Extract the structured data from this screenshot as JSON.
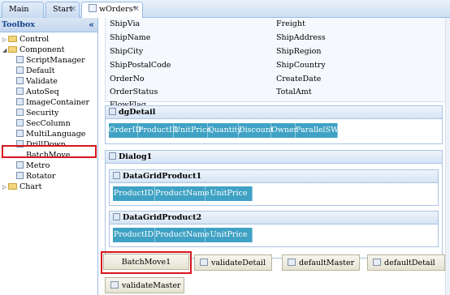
{
  "tabs": [
    {
      "label": "Main"
    },
    {
      "label": "Start"
    },
    {
      "label": "wOrders*"
    }
  ],
  "toolbox": {
    "title": "Toolbox",
    "items": [
      {
        "label": "Control"
      },
      {
        "label": "Component"
      },
      {
        "label": "ScriptManager"
      },
      {
        "label": "Default"
      },
      {
        "label": "Validate"
      },
      {
        "label": "AutoSeq"
      },
      {
        "label": "ImageContainer"
      },
      {
        "label": "Security"
      },
      {
        "label": "SecColumn"
      },
      {
        "label": "MultiLanguage"
      },
      {
        "label": "DrillDown"
      },
      {
        "label": "BatchMove"
      },
      {
        "label": "Metro"
      },
      {
        "label": "Rotator"
      },
      {
        "label": "Chart"
      }
    ]
  },
  "form": {
    "left": [
      "ShipVia",
      "ShipName",
      "ShipCity",
      "ShipPostalCode",
      "OrderNo",
      "OrderStatus",
      "FlowFlag"
    ],
    "right": [
      "Freight",
      "ShipAddress",
      "ShipRegion",
      "ShipCountry",
      "CreateDate",
      "TotalAmt"
    ]
  },
  "dgDetail": {
    "title": "dgDetail",
    "columns": [
      "OrderID",
      "ProductID",
      "UnitPrice",
      "Quantity",
      "Discount",
      "Owner",
      "ParallelSWT"
    ]
  },
  "dialog": {
    "title": "Dialog1",
    "grids": [
      {
        "title": "DataGridProduct1",
        "columns": [
          "ProductID",
          "ProductName",
          "UnitPrice"
        ]
      },
      {
        "title": "DataGridProduct2",
        "columns": [
          "ProductID",
          "ProductName",
          "UnitPrice"
        ]
      }
    ]
  },
  "components": [
    "BatchMove1",
    "validateDetail",
    "defaultMaster",
    "defaultDetail",
    "validateMaster"
  ],
  "colors": {
    "grid_header": "#3fa2c4",
    "highlight": "#d8151d",
    "border": "#99bbe8"
  }
}
